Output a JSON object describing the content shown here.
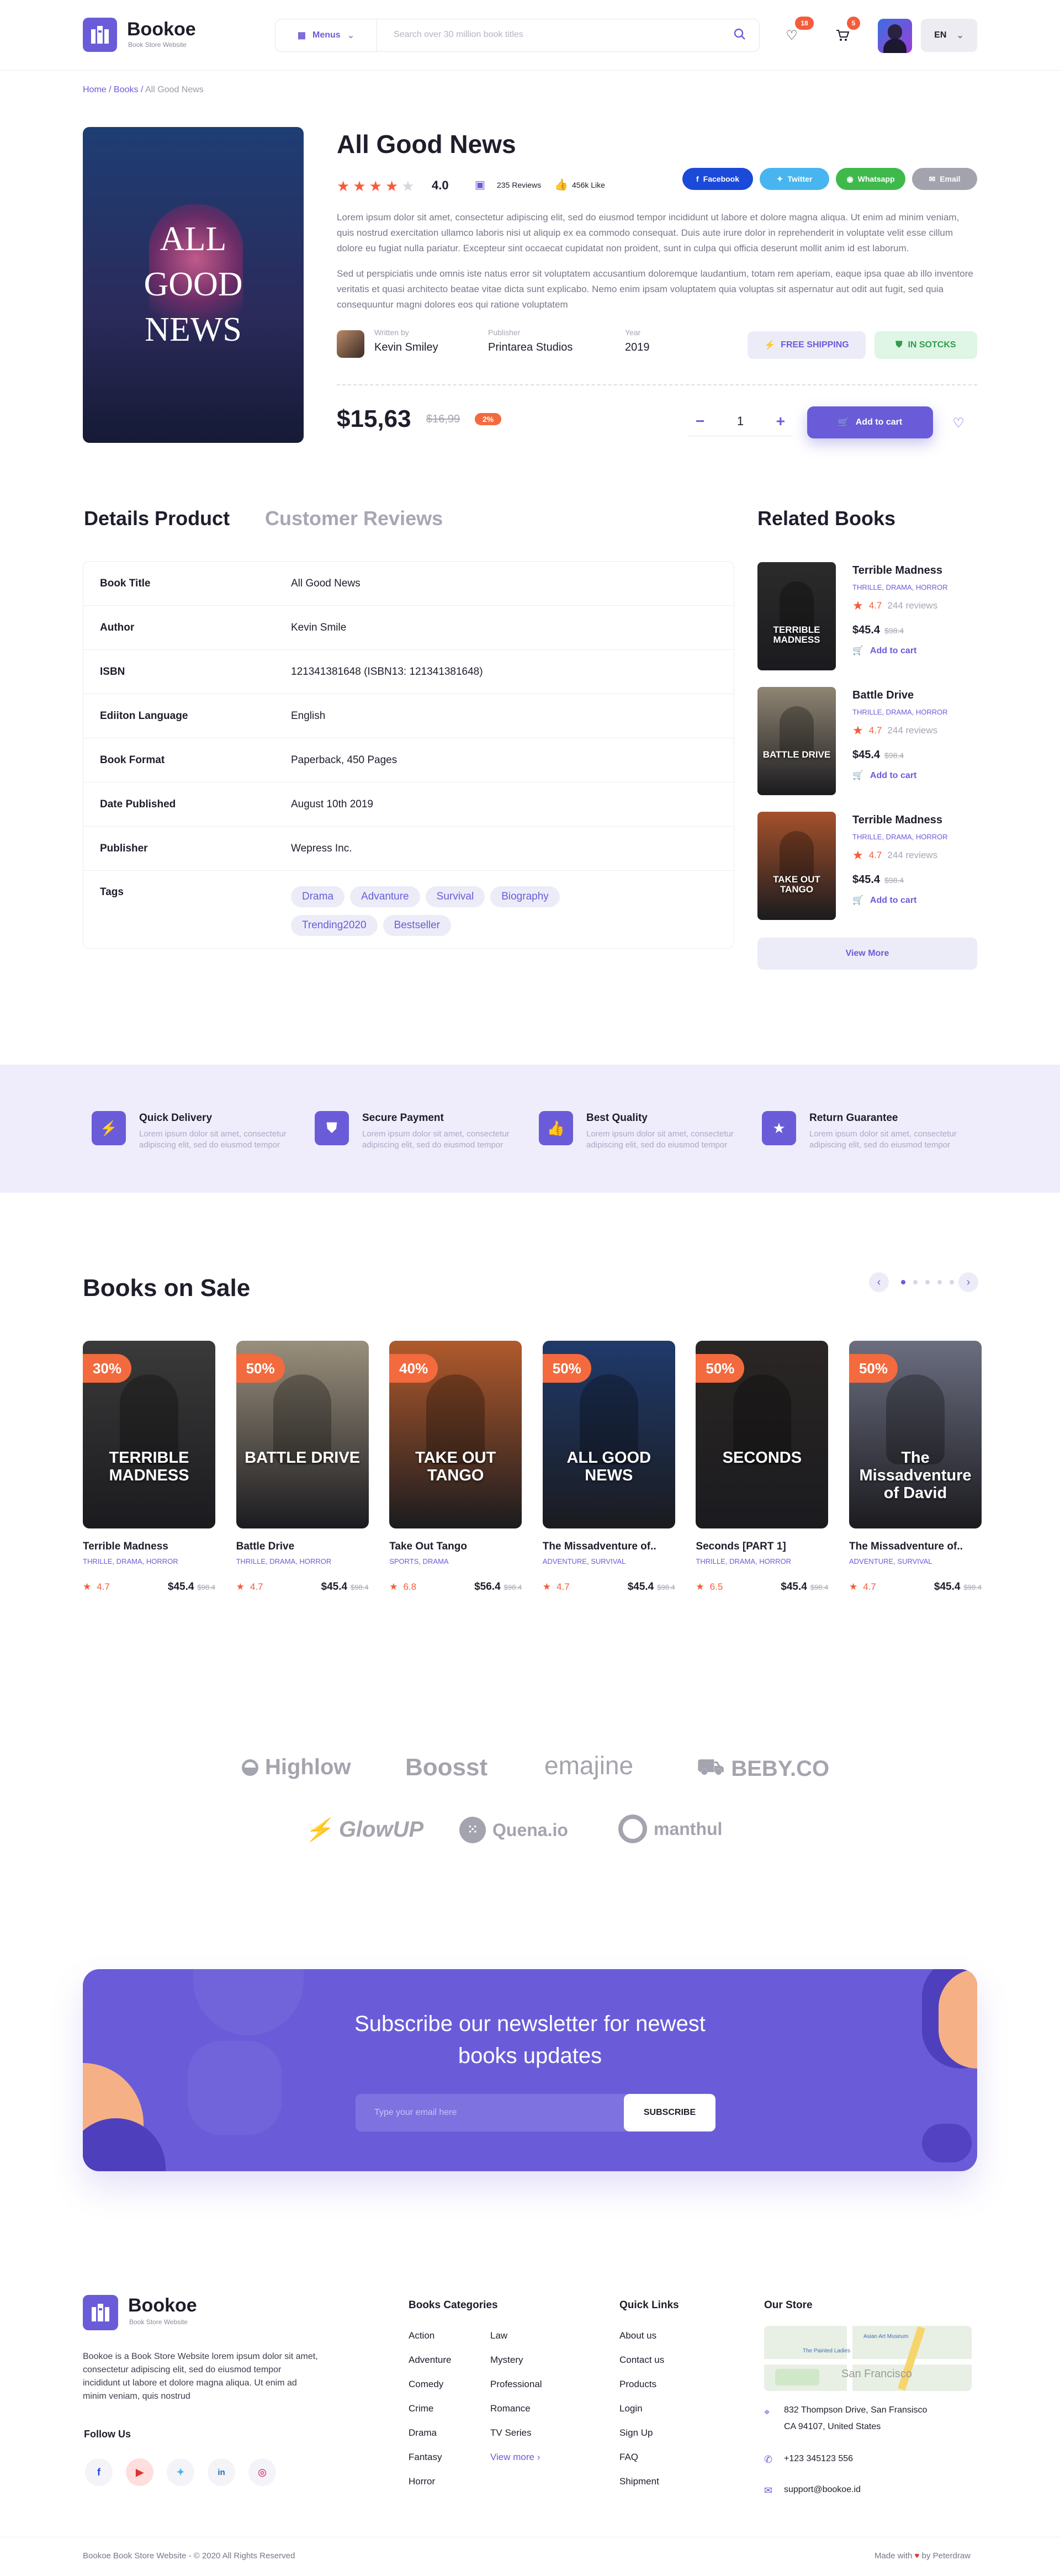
{
  "brand": {
    "name": "Bookoe",
    "tagline": "Book Store Website"
  },
  "header": {
    "menus_label": "Menus",
    "search_placeholder": "Search over 30 million book titles",
    "wishlist_count": "18",
    "cart_count": "5",
    "language": "EN"
  },
  "breadcrumb": {
    "home": "Home",
    "books": "Books",
    "current": "All Good News"
  },
  "product": {
    "title": "All Good News",
    "rating": "4.0",
    "rating_stars": 4,
    "reviews": "235 Reviews",
    "likes": "456k Like",
    "share": {
      "facebook": "Facebook",
      "twitter": "Twitter",
      "whatsapp": "Whatsapp",
      "email": "Email"
    },
    "desc1": "Lorem ipsum dolor sit amet, consectetur adipiscing elit, sed do eiusmod tempor incididunt ut labore et dolore magna aliqua. Ut enim ad minim veniam, quis nostrud exercitation ullamco laboris nisi ut aliquip ex ea commodo consequat. Duis aute irure dolor in reprehenderit in voluptate velit esse cillum dolore eu fugiat nulla pariatur. Excepteur sint occaecat cupidatat non proident, sunt in culpa qui officia deserunt mollit anim id est laborum.",
    "desc2": "Sed ut perspiciatis unde omnis iste natus error sit voluptatem accusantium doloremque laudantium, totam rem aperiam, eaque ipsa quae ab illo inventore veritatis et quasi architecto beatae vitae dicta sunt explicabo. Nemo enim ipsam voluptatem quia voluptas sit aspernatur aut odit aut fugit, sed quia consequuntur magni dolores eos qui ratione voluptatem",
    "written_by_label": "Written by",
    "author": "Kevin Smiley",
    "publisher_label": "Publisher",
    "publisher": "Printarea Studios",
    "year_label": "Year",
    "year": "2019",
    "free_shipping": "FREE SHIPPING",
    "in_stock": "IN SOTCKS",
    "price": "$15,63",
    "old_price": "$16,99",
    "discount": "2%",
    "quantity": "1",
    "add_to_cart": "Add to cart",
    "cover_text": [
      "ALL",
      "GOOD",
      "NEWS"
    ]
  },
  "details": {
    "tab_details": "Details Product",
    "tab_reviews": "Customer Reviews",
    "rows": [
      {
        "k": "Book Title",
        "v": "All Good News"
      },
      {
        "k": "Author",
        "v": "Kevin Smile"
      },
      {
        "k": "ISBN",
        "v": "121341381648 (ISBN13: 121341381648)"
      },
      {
        "k": "Ediiton Language",
        "v": "English"
      },
      {
        "k": "Book Format",
        "v": "Paperback, 450 Pages"
      },
      {
        "k": "Date Published",
        "v": "August 10th 2019"
      },
      {
        "k": "Publisher",
        "v": "Wepress Inc."
      }
    ],
    "tags_label": "Tags",
    "tags": [
      "Drama",
      "Advanture",
      "Survival",
      "Biography",
      "Trending2020",
      "Bestseller"
    ]
  },
  "related": {
    "title": "Related Books",
    "view_more": "View More",
    "books": [
      {
        "title": "Terrible Madness",
        "cat": "THRILLE, DRAMA, HORROR",
        "rating": "4.7",
        "reviews": "244 reviews",
        "price": "$45.4",
        "old": "$98.4",
        "add": "Add to cart",
        "cover": "TERRIBLE MADNESS",
        "bg": "#2b2b2b"
      },
      {
        "title": "Battle Drive",
        "cat": "THRILLE, DRAMA, HORROR",
        "rating": "4.7",
        "reviews": "244 reviews",
        "price": "$45.4",
        "old": "$98.4",
        "add": "Add to cart",
        "cover": "BATTLE DRIVE",
        "bg": "#8f8572"
      },
      {
        "title": "Terrible Madness",
        "cat": "THRILLE, DRAMA, HORROR",
        "rating": "4.7",
        "reviews": "244 reviews",
        "price": "$45.4",
        "old": "$98.4",
        "add": "Add to cart",
        "cover": "TAKE OUT TANGO",
        "bg": "#a5512b"
      }
    ]
  },
  "features": [
    {
      "title": "Quick Delivery",
      "desc": "Lorem ipsum dolor sit amet, consectetur adipiscing elit, sed do eiusmod tempor"
    },
    {
      "title": "Secure Payment",
      "desc": "Lorem ipsum dolor sit amet, consectetur adipiscing elit, sed do eiusmod tempor"
    },
    {
      "title": "Best Quality",
      "desc": "Lorem ipsum dolor sit amet, consectetur adipiscing elit, sed do eiusmod tempor"
    },
    {
      "title": "Return Guarantee",
      "desc": "Lorem ipsum dolor sit amet, consectetur adipiscing elit, sed do eiusmod tempor"
    }
  ],
  "sale": {
    "title": "Books on Sale",
    "books": [
      {
        "discount": "30%",
        "title": "Terrible Madness",
        "cat": "THRILLE, DRAMA, HORROR",
        "rating": "4.7",
        "price": "$45.4",
        "old": "$98.4",
        "cover": "TERRIBLE MADNESS",
        "bg": "#3a3a3a"
      },
      {
        "discount": "50%",
        "title": "Battle Drive",
        "cat": "THRILLE, DRAMA, HORROR",
        "rating": "4.7",
        "price": "$45.4",
        "old": "$98.4",
        "cover": "BATTLE DRIVE",
        "bg": "#9a8f7c"
      },
      {
        "discount": "40%",
        "title": "Take Out Tango",
        "cat": "SPORTS, DRAMA",
        "rating": "6.8",
        "price": "$56.4",
        "old": "$98.4",
        "cover": "TAKE OUT TANGO",
        "bg": "#b15a2c"
      },
      {
        "discount": "50%",
        "title": "The Missadventure of..",
        "cat": "ADVENTURE, SURVIVAL",
        "rating": "4.7",
        "price": "$45.4",
        "old": "$98.4",
        "cover": "ALL GOOD NEWS",
        "bg": "#1f3a6b"
      },
      {
        "discount": "50%",
        "title": "Seconds [PART 1]",
        "cat": "THRILLE, DRAMA, HORROR",
        "rating": "6.5",
        "price": "$45.4",
        "old": "$98.4",
        "cover": "SECONDS",
        "bg": "#2a2624"
      },
      {
        "discount": "50%",
        "title": "The Missadventure of..",
        "cat": "ADVENTURE, SURVIVAL",
        "rating": "4.7",
        "price": "$45.4",
        "old": "$98.4",
        "cover": "The Missadventure of David",
        "bg": "#6b6e80"
      }
    ]
  },
  "brands": [
    "Highlow",
    "Boosst",
    "emajine",
    "BEBY.CO",
    "GlowUP",
    "Quena.io",
    "manthul"
  ],
  "newsletter": {
    "title": "Subscribe our newsletter for newest books updates",
    "placeholder": "Type your email here",
    "button": "SUBSCRIBE"
  },
  "footer": {
    "about": "Bookoe is a Book Store Website lorem ipsum dolor sit amet, consectetur adipiscing elit, sed do eiusmod tempor incididunt ut labore et dolore magna aliqua. Ut enim ad minim veniam, quis nostrud",
    "follow_us": "Follow Us",
    "categories_title": "Books Categories",
    "categories_col1": [
      "Action",
      "Adventure",
      "Comedy",
      "Crime",
      "Drama",
      "Fantasy",
      "Horror"
    ],
    "categories_col2": [
      "Law",
      "Mystery",
      "Professional",
      "Romance",
      "TV Series"
    ],
    "view_more": "View more",
    "links_title": "Quick Links",
    "links": [
      "About us",
      "Contact us",
      "Products",
      "Login",
      "Sign Up",
      "FAQ",
      "Shipment"
    ],
    "store_title": "Our Store",
    "map_labels": [
      "Asian Art Museum",
      "The Painted Ladies",
      "San Francisco"
    ],
    "address1": "832  Thompson Drive, San Fransisco",
    "address2": "CA 94107, United States",
    "phone": "+123 345123 556",
    "email": "support@bookoe.id",
    "copyright": "Bookoe Book Store Website  -  © 2020 All Rights Reserved",
    "made_with": "Made with",
    "by": "by Peterdraw"
  }
}
